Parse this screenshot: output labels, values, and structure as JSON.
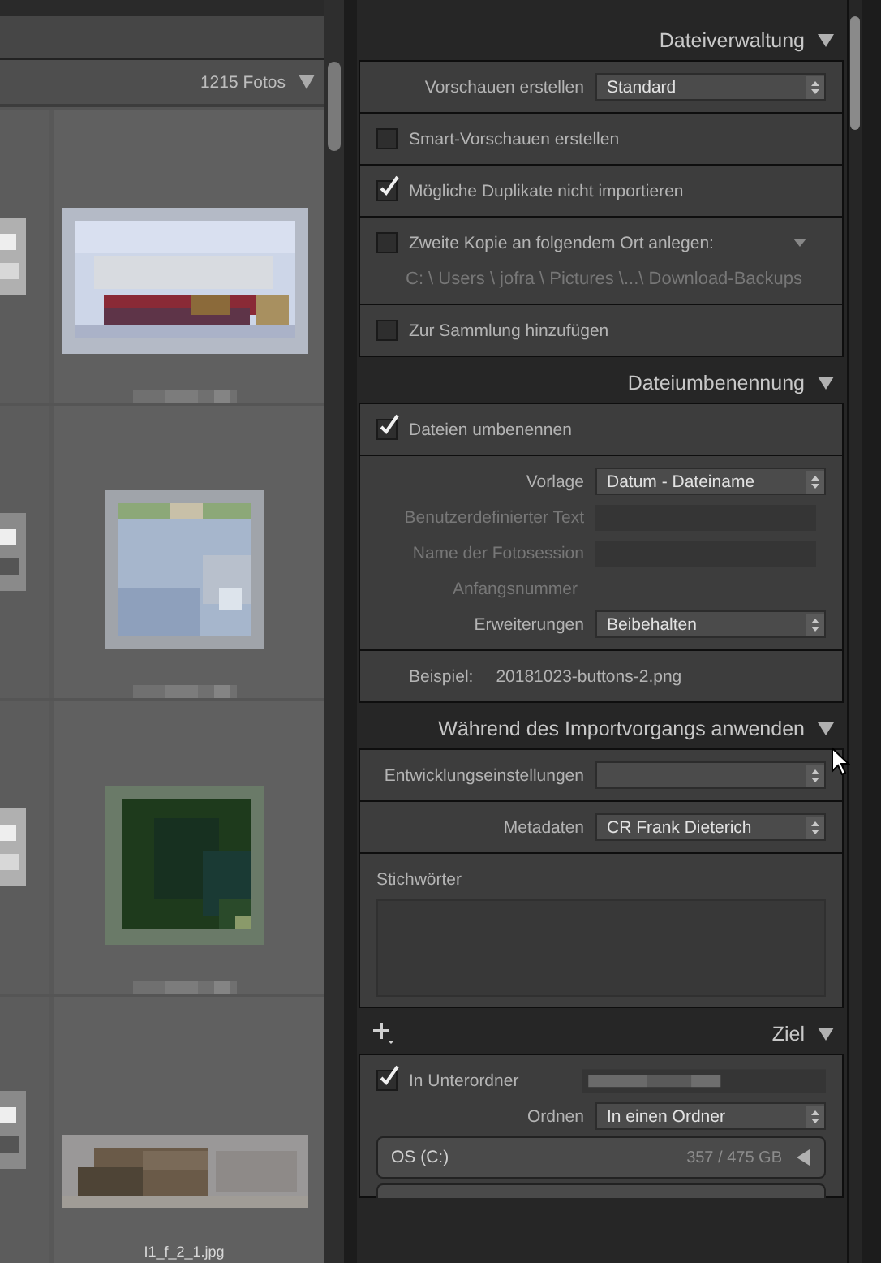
{
  "grid": {
    "count": "1215 Fotos",
    "filename": "I1_f_2_1.jpg"
  },
  "panels": [
    {
      "title": "Dateiverwaltung",
      "expanded": true,
      "add_menu": false,
      "sections": [
        {
          "items": [
            {
              "kind": "select",
              "label": "Vorschauen erstellen",
              "value": "Standard"
            }
          ]
        },
        {
          "items": [
            {
              "kind": "checkbox",
              "label": "Smart-Vorschauen erstellen",
              "checked": false
            }
          ]
        },
        {
          "items": [
            {
              "kind": "checkbox",
              "label": "Mögliche Duplikate nicht importieren",
              "checked": true
            }
          ]
        },
        {
          "items": [
            {
              "kind": "checkbox-menu",
              "label": "Zweite Kopie an folgendem Ort anlegen:",
              "checked": false
            },
            {
              "kind": "path",
              "text": "C: \\ Users \\ jofra \\ Pictures \\...\\ Download-Backups"
            }
          ]
        },
        {
          "items": [
            {
              "kind": "checkbox",
              "label": "Zur Sammlung hinzufügen",
              "checked": false
            }
          ]
        }
      ]
    },
    {
      "title": "Dateiumbenennung",
      "expanded": true,
      "add_menu": false,
      "sections": [
        {
          "items": [
            {
              "kind": "checkbox",
              "label": "Dateien umbenennen",
              "checked": true
            }
          ]
        },
        {
          "items": [
            {
              "kind": "select",
              "label": "Vorlage",
              "value": "Datum - Dateiname"
            },
            {
              "kind": "field",
              "label": "Benutzerdefinierter Text",
              "disabled": true
            },
            {
              "kind": "field",
              "label": "Name der Fotosession",
              "disabled": true
            },
            {
              "kind": "text",
              "label": "Anfangsnummer",
              "disabled": true
            },
            {
              "kind": "select",
              "label": "Erweiterungen",
              "value": "Beibehalten"
            }
          ]
        },
        {
          "items": [
            {
              "kind": "example",
              "label": "Beispiel:",
              "value": "20181023-buttons-2.png"
            }
          ]
        }
      ]
    },
    {
      "title": "Während des Importvorgangs anwenden",
      "expanded": true,
      "add_menu": false,
      "sections": [
        {
          "items": [
            {
              "kind": "select",
              "label": "Entwicklungseinstellungen",
              "value": ""
            }
          ]
        },
        {
          "items": [
            {
              "kind": "select",
              "label": "Metadaten",
              "value": "CR Frank Dieterich"
            }
          ]
        },
        {
          "items": [
            {
              "kind": "keywords",
              "label": "Stichwörter"
            }
          ]
        }
      ]
    },
    {
      "title": "Ziel",
      "expanded": true,
      "add_menu": true,
      "sections": [
        {
          "items": [
            {
              "kind": "subfolder",
              "label": "In Unterordner",
              "checked": true
            },
            {
              "kind": "select",
              "label": "Ordnen",
              "value": "In einen Ordner"
            },
            {
              "kind": "drive",
              "name": "OS (C:)",
              "usage": "357 / 475 GB",
              "expanded": false
            },
            {
              "kind": "drive-edge"
            }
          ]
        }
      ]
    }
  ]
}
